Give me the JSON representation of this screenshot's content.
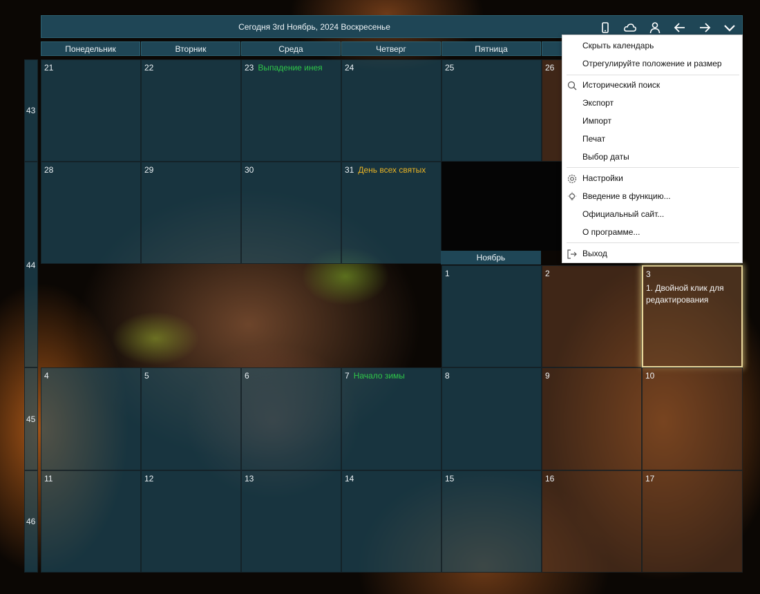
{
  "header": {
    "today_label": "Сегодня 3rd Ноябрь, 2024 Воскресенье"
  },
  "toolbar": {
    "icons": [
      "phone-icon",
      "cloud-icon",
      "user-icon",
      "arrow-left-icon",
      "arrow-right-icon",
      "chevron-down-icon"
    ]
  },
  "weekdays": [
    "Понедельник",
    "Вторник",
    "Среда",
    "Четверг",
    "Пятница"
  ],
  "weeks": [
    "43",
    "44",
    "45",
    "46"
  ],
  "month_label": "Ноябрь",
  "days": {
    "d21": "21",
    "d22": "22",
    "d23": "23",
    "d24": "24",
    "d25": "25",
    "d26": "26",
    "d28": "28",
    "d29": "29",
    "d30": "30",
    "d31": "31",
    "d1": "1",
    "d2": "2",
    "d3": "3",
    "d4": "4",
    "d5": "5",
    "d6": "6",
    "d7": "7",
    "d8": "8",
    "d9": "9",
    "d10": "10",
    "d11": "11",
    "d12": "12",
    "d13": "13",
    "d14": "14",
    "d15": "15",
    "d16": "16",
    "d17": "17"
  },
  "events": {
    "e23": "Выпадение инея",
    "e31": "День всех святых",
    "e7": "Начало зимы",
    "note3": "1. Двойной клик для редактирования"
  },
  "menu": {
    "hide": "Скрыть календарь",
    "adjust": "Отрегулируйте положение и размер",
    "history": "Исторический поиск",
    "export": "Экспорт",
    "import": "Импорт",
    "print": "Печат",
    "date_select": "Выбор даты",
    "settings": "Настройки",
    "intro": "Введение в функцию...",
    "site": "Официальный сайт...",
    "about": "О программе...",
    "exit": "Выход"
  },
  "colors": {
    "header_bg": "#1f4656",
    "green_event": "#2fc74a",
    "yellow_event": "#e8b325",
    "today_border": "#e8d79a"
  }
}
